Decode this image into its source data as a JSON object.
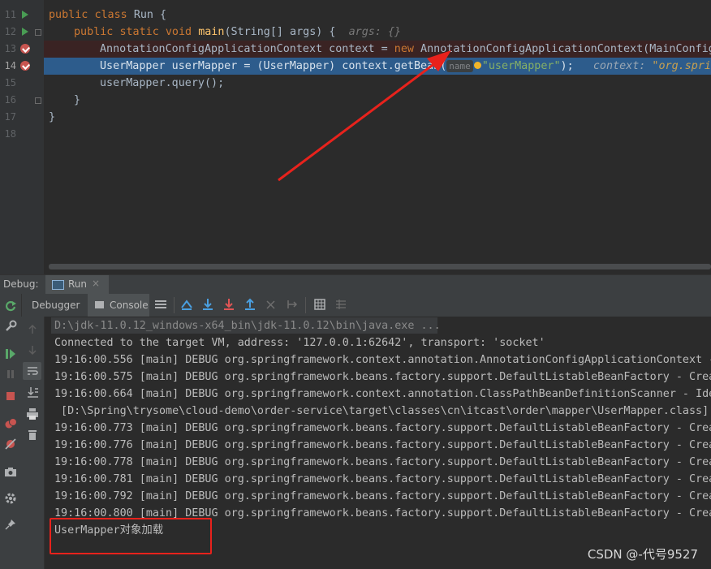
{
  "editor": {
    "line_numbers": [
      "11",
      "12",
      "13",
      "14",
      "15",
      "16",
      "17",
      "18"
    ],
    "lines": {
      "l11": [
        "public ",
        "class ",
        "Run {"
      ],
      "l12": [
        "public ",
        "static ",
        "void ",
        "main",
        "(String[] args) {",
        "args: {}"
      ],
      "l13": [
        "AnnotationConfigApplicationContext context = ",
        "new ",
        "AnnotationConfigApplicationContext(MainConfig"
      ],
      "l14": [
        "UserMapper userMapper = (UserMapper) context.getBean(",
        "name",
        "\"userMapper\"",
        ");",
        "context: ",
        "\"org.spring"
      ],
      "l15": "userMapper.query();",
      "l16": "}",
      "l17": "}"
    }
  },
  "debug": {
    "title": "Debug:",
    "tab_run": "Run",
    "tab_close": "×",
    "debugger_tab": "Debugger",
    "console_tab": "Console"
  },
  "console": {
    "lines": [
      "D:\\jdk-11.0.12_windows-x64_bin\\jdk-11.0.12\\bin\\java.exe ...",
      "Connected to the target VM, address: '127.0.0.1:62642', transport: 'socket'",
      "19:16:00.556 [main] DEBUG org.springframework.context.annotation.AnnotationConfigApplicationContext -",
      "19:16:00.575 [main] DEBUG org.springframework.beans.factory.support.DefaultListableBeanFactory - Crea",
      "19:16:00.664 [main] DEBUG org.springframework.context.annotation.ClassPathBeanDefinitionScanner - Ide",
      " [D:\\Spring\\trysome\\cloud-demo\\order-service\\target\\classes\\cn\\itcast\\order\\mapper\\UserMapper.class]",
      "19:16:00.773 [main] DEBUG org.springframework.beans.factory.support.DefaultListableBeanFactory - Crea",
      "19:16:00.776 [main] DEBUG org.springframework.beans.factory.support.DefaultListableBeanFactory - Crea",
      "19:16:00.778 [main] DEBUG org.springframework.beans.factory.support.DefaultListableBeanFactory - Crea",
      "19:16:00.781 [main] DEBUG org.springframework.beans.factory.support.DefaultListableBeanFactory - Crea",
      "19:16:00.792 [main] DEBUG org.springframework.beans.factory.support.DefaultListableBeanFactory - Crea",
      "19:16:00.800 [main] DEBUG org.springframework.beans.factory.support.DefaultListableBeanFactory - Crea",
      "UserMapper对象加载"
    ]
  },
  "watermark": "CSDN @-代号9527",
  "colors": {
    "annotation_red": "#e8221c",
    "breakpoint": "#c75450",
    "exec_line": "#2d5c8c"
  },
  "icons": {
    "left_toolbar": [
      "rerun-icon",
      "wrench-icon",
      "resume-icon",
      "pause-icon",
      "stop-icon",
      "view-breakpoints-icon",
      "mute-breakpoints-icon",
      "camera-icon",
      "settings-icon",
      "pin-icon"
    ],
    "second_toolbar": [
      "up-arrow-icon",
      "down-arrow-icon",
      "soft-wrap-icon",
      "scroll-to-end-icon",
      "print-icon",
      "trash-icon"
    ],
    "top_toolbar": [
      "menu-lines-icon",
      "show-execution-point-icon",
      "step-over-icon",
      "step-into-icon",
      "force-step-into-icon",
      "step-out-icon",
      "drop-frame-icon",
      "run-to-cursor-icon",
      "evaluate-expression-icon",
      "trace-icon"
    ]
  }
}
